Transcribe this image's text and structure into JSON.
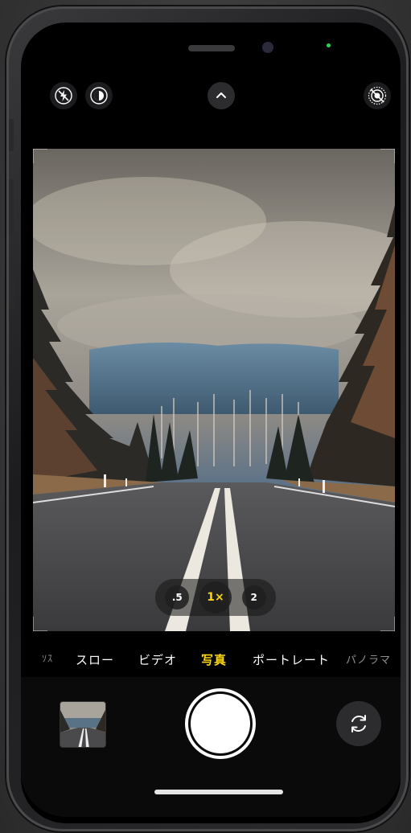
{
  "top_bar": {
    "flash_icon": "flash-off-icon",
    "live_icon": "live-photo-icon",
    "expand_icon": "chevron-up-icon",
    "filter_icon": "live-off-icon"
  },
  "zoom": {
    "options": [
      ".5",
      "1×",
      "2"
    ],
    "selected": "1×"
  },
  "modes": {
    "items": [
      "ｿｽ",
      "スロー",
      "ビデオ",
      "写真",
      "ポートレート",
      "パノラマ"
    ],
    "selected": "写真"
  },
  "colors": {
    "accent": "#ffd60a",
    "background": "#000000",
    "indicator": "#30d158"
  }
}
